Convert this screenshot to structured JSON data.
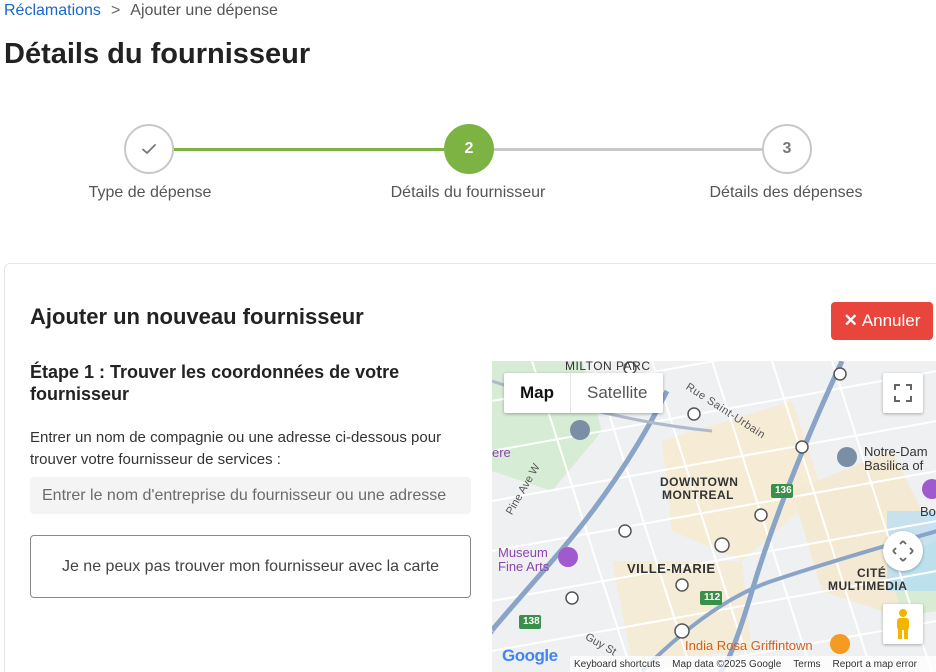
{
  "breadcrumb": {
    "link": "Réclamations",
    "separator": ">",
    "current": "Ajouter une dépense"
  },
  "page": {
    "title": "Détails du fournisseur"
  },
  "stepper": {
    "steps": [
      {
        "number": "",
        "label": "Type de dépense",
        "status": "completed"
      },
      {
        "number": "2",
        "label": "Détails du fournisseur",
        "status": "active"
      },
      {
        "number": "3",
        "label": "Détails des dépenses",
        "status": "upcoming"
      }
    ],
    "colors": {
      "active": "#7cb342",
      "inactive": "#c9c9c9"
    }
  },
  "card": {
    "title": "Ajouter un nouveau fournisseur",
    "cancel_label": "Annuler",
    "cancel_color": "#e8453c",
    "step_heading": "Étape 1 : Trouver les coordonnées de votre fournisseur",
    "instructions": "Entrer un nom de compagnie ou une adresse ci-dessous pour trouver votre fournisseur de services :",
    "search_placeholder": "Entrer le nom d'entreprise du fournisseur ou une adresse",
    "search_value": "",
    "cant_find_label": "Je ne peux pas trouver mon fournisseur avec la carte"
  },
  "map": {
    "type_map": "Map",
    "type_satellite": "Satellite",
    "labels": {
      "milton_parc": "MILTON PARC",
      "rue_saint_urbain": "Rue Saint-Urbain",
      "downtown_1": "DOWNTOWN",
      "downtown_2": "MONTREAL",
      "notre_dame_1": "Notre-Dam",
      "notre_dame_2": "Basilica of",
      "pine_ave": "Pine Ave W",
      "museum_1": "Museum",
      "museum_2": "Fine Arts",
      "ville_marie": "VILLE-MARIE",
      "cite_1": "CITÉ",
      "cite_2": "MULTIMEDIA",
      "guy_st": "Guy St",
      "india_rosa": "India Rosa Griffintown",
      "route_136": "136",
      "route_112": "112",
      "route_138": "138",
      "ere": "ere",
      "bo": "Bo"
    },
    "footer": {
      "google": "Google",
      "shortcuts": "Keyboard shortcuts",
      "copyright": "Map data ©2025 Google",
      "terms": "Terms",
      "report": "Report a map error"
    }
  }
}
